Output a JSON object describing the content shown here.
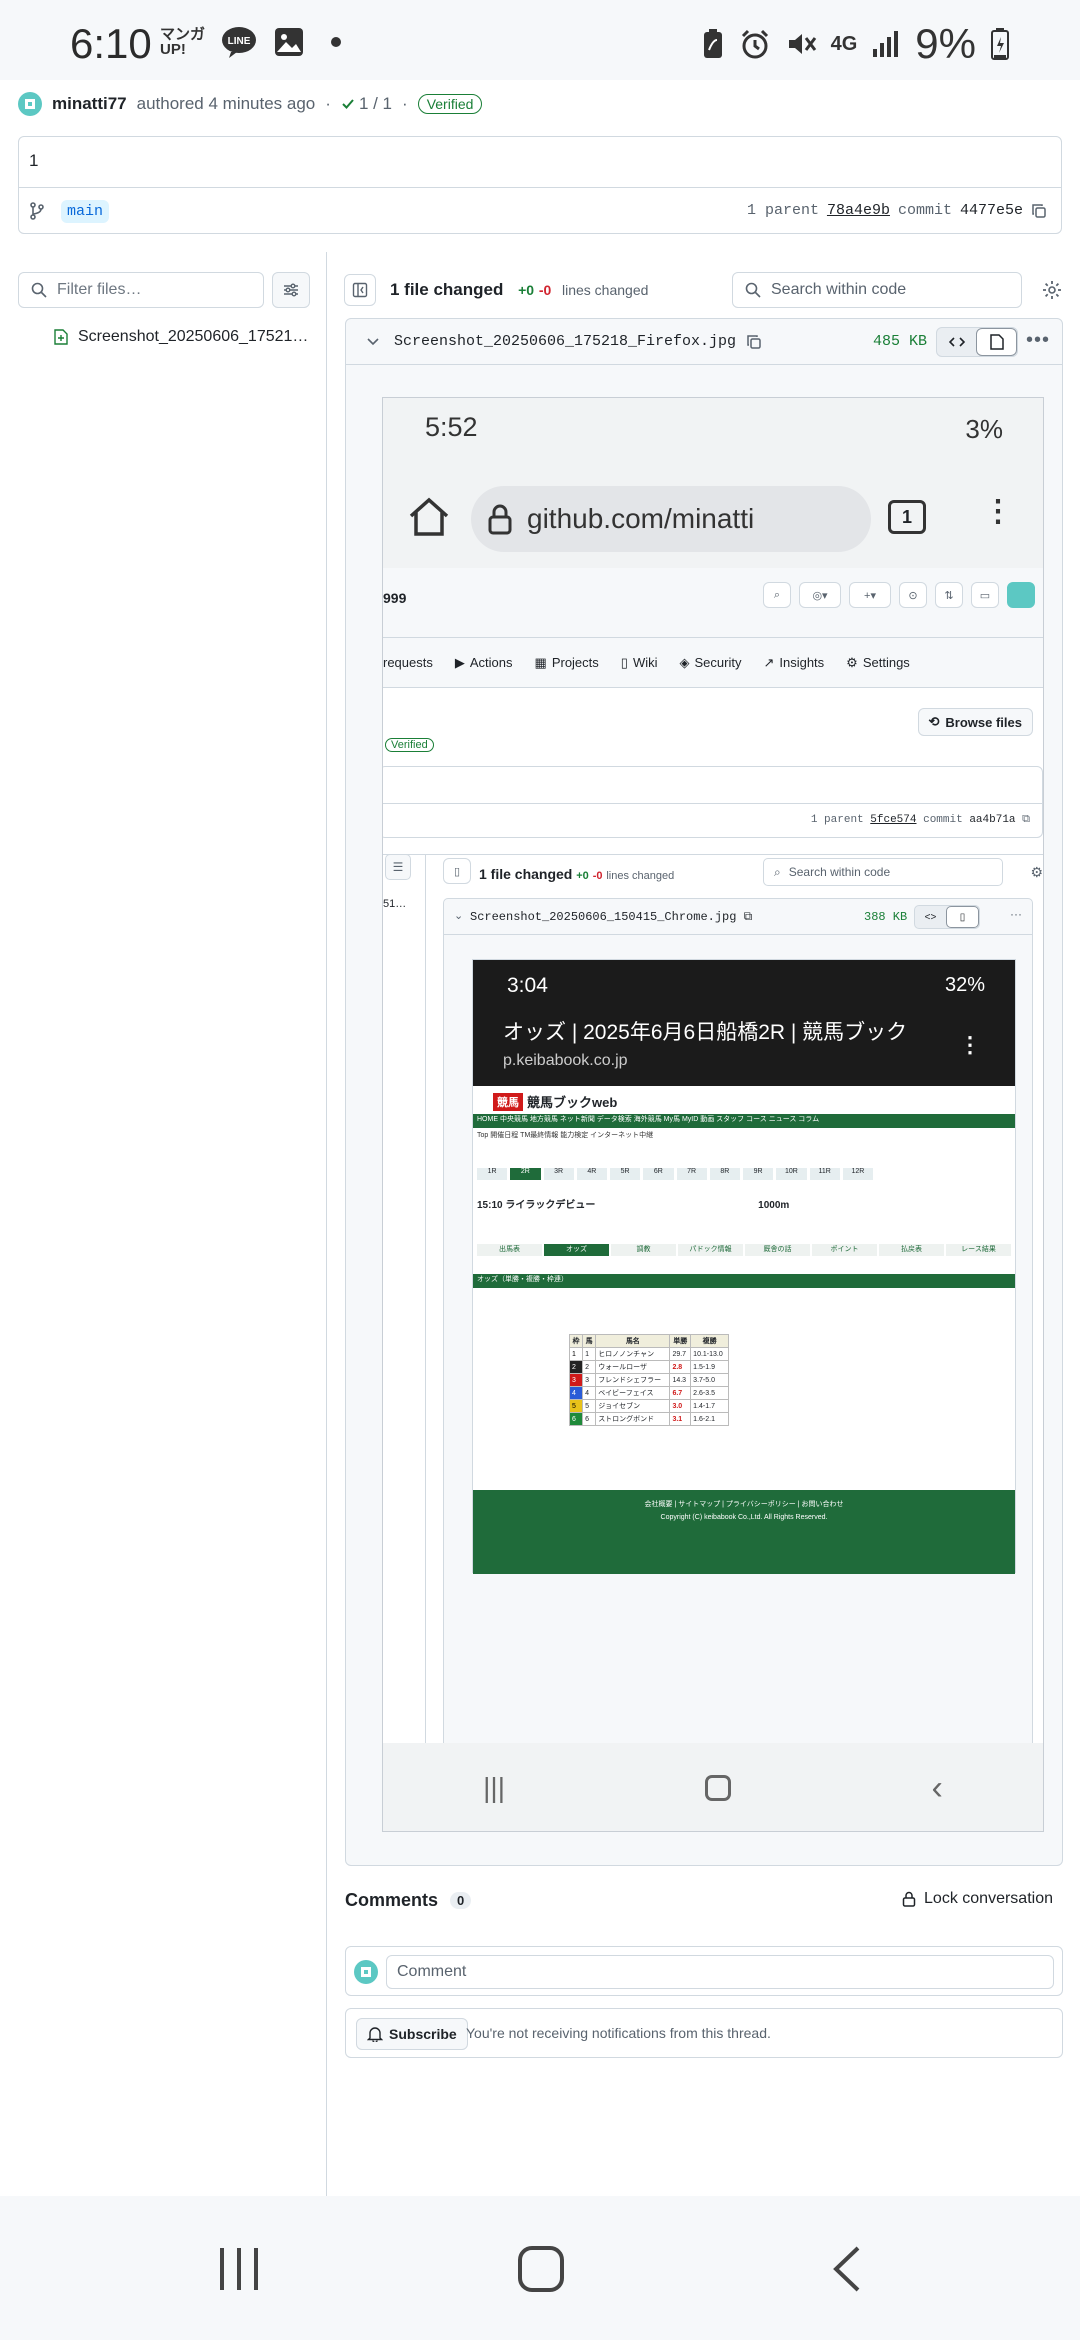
{
  "status_bar": {
    "time": "6:10",
    "battery": "9%",
    "network": "4G",
    "app_icons": [
      "manga-up-icon",
      "line-icon",
      "gallery-icon"
    ]
  },
  "commit": {
    "author": "minatti77",
    "authored": "authored 4 minutes ago",
    "checks": "1 / 1",
    "verified": "Verified",
    "message": "1",
    "branch": "main",
    "parent_label": "1 parent",
    "parent_sha": "78a4e9b",
    "commit_label": "commit",
    "commit_sha": "4477e5e"
  },
  "sidebar": {
    "filter_placeholder": "Filter files…",
    "files": [
      {
        "name": "Screenshot_20250606_17521…"
      }
    ]
  },
  "diff": {
    "files_changed": "1 file changed",
    "additions": "+0",
    "deletions": "-0",
    "lines_changed": "lines changed",
    "search_placeholder": "Search within code",
    "file": {
      "name": "Screenshot_20250606_175218_Firefox.jpg",
      "size": "485 KB"
    }
  },
  "nested_firefox": {
    "time": "5:52",
    "battery": "3%",
    "url": "github.com/minatti",
    "tab_count": "1",
    "repo_fragment": "999",
    "nav": [
      "requests",
      "Actions",
      "Projects",
      "Wiki",
      "Security",
      "Insights",
      "Settings"
    ],
    "browse_files": "Browse files",
    "verified": "Verified",
    "parent_label": "1 parent",
    "parent_sha": "5fce574",
    "commit_label": "commit",
    "commit_sha": "aa4b71a",
    "files_changed": "1 file changed",
    "additions": "+0",
    "deletions": "-0",
    "lines_changed": "lines changed",
    "search_placeholder": "Search within code",
    "file_name": "Screenshot_20250606_150415_Chrome.jpg",
    "file_size": "388 KB",
    "sidebar_fragment": "51…"
  },
  "nested_chrome": {
    "time": "3:04",
    "battery": "32%",
    "title": "オッズ | 2025年6月6日船橋2R | 競馬ブック",
    "url": "p.keibabook.co.jp",
    "site_logo": "競馬ブックweb",
    "race_name": "ライラックデビュー",
    "race_time": "15:10",
    "distance": "1000m",
    "section": "オッズ（単勝・複勝・枠連）",
    "horses": [
      {
        "no": "1",
        "name": "ヒロノノンチャン",
        "win": "29.7",
        "place": "10.1-13.0"
      },
      {
        "no": "2",
        "name": "ウォールローザ",
        "win": "2.8",
        "place": "1.5-1.9"
      },
      {
        "no": "3",
        "name": "フレンドシェフラー",
        "win": "14.3",
        "place": "3.7-5.0"
      },
      {
        "no": "4",
        "name": "ベイビーフェイス",
        "win": "6.7",
        "place": "2.6-3.5"
      },
      {
        "no": "5",
        "name": "ジョイセブン",
        "win": "3.0",
        "place": "1.4-1.7"
      },
      {
        "no": "6",
        "name": "ストロングボンド",
        "win": "3.1",
        "place": "1.6-2.1"
      }
    ],
    "copyright": "Copyright (C) keibabook Co.,Ltd. All Rights Reserved."
  },
  "comments": {
    "title": "Comments",
    "count": "0",
    "lock": "Lock conversation",
    "placeholder": "Comment",
    "subscribe": "Subscribe",
    "subscribe_note": "You're not receiving notifications from this thread."
  }
}
